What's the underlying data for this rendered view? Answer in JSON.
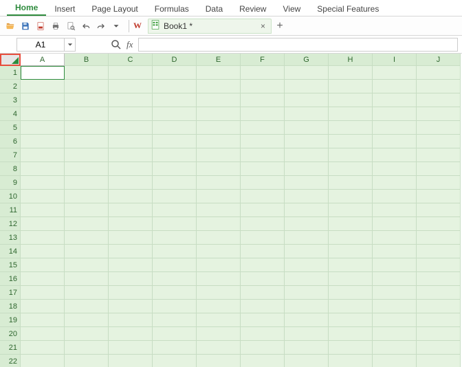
{
  "ribbon": {
    "tabs": [
      "Home",
      "Insert",
      "Page Layout",
      "Formulas",
      "Data",
      "Review",
      "View",
      "Special Features"
    ],
    "active_index": 0
  },
  "quick_access": {
    "icons": [
      "open-folder",
      "save",
      "export-pdf",
      "print",
      "print-preview",
      "undo",
      "redo",
      "dropdown"
    ]
  },
  "app_marker": "W",
  "document_tab": {
    "label": "Book1 *",
    "close_glyph": "×"
  },
  "new_tab_glyph": "+",
  "namebox": {
    "value": "A1"
  },
  "fx": {
    "label": "fx"
  },
  "formula_bar": {
    "value": ""
  },
  "columns": [
    "A",
    "B",
    "C",
    "D",
    "E",
    "F",
    "G",
    "H",
    "I",
    "J"
  ],
  "rows": [
    "1",
    "2",
    "3",
    "4",
    "5",
    "6",
    "7",
    "8",
    "9",
    "10",
    "11",
    "12",
    "13",
    "14",
    "15",
    "16",
    "17",
    "18",
    "19",
    "20",
    "21",
    "22"
  ],
  "active_cell": {
    "row": 0,
    "col": 0
  }
}
